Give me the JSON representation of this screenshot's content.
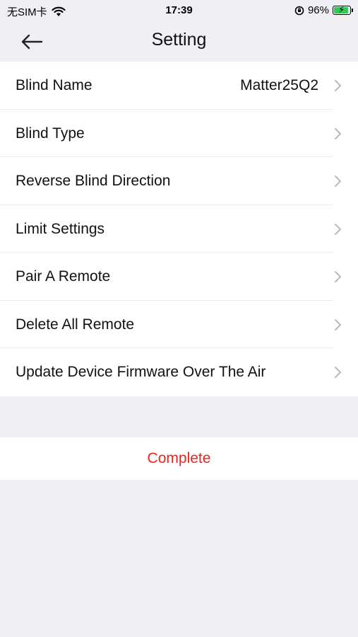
{
  "status_bar": {
    "carrier": "无SIM卡",
    "time": "17:39",
    "battery": "96%",
    "battery_level": 0.96,
    "battery_color": "#35c759"
  },
  "nav": {
    "title": "Setting",
    "back_icon": "arrow-left-icon"
  },
  "rows": [
    {
      "label": "Blind Name",
      "value": "Matter25Q2"
    },
    {
      "label": "Blind Type"
    },
    {
      "label": "Reverse Blind Direction"
    },
    {
      "label": "Limit Settings"
    },
    {
      "label": "Pair A Remote"
    },
    {
      "label": "Delete All Remote"
    },
    {
      "label": "Update Device Firmware Over The Air"
    }
  ],
  "complete": {
    "label": "Complete",
    "color": "#e8261f"
  }
}
